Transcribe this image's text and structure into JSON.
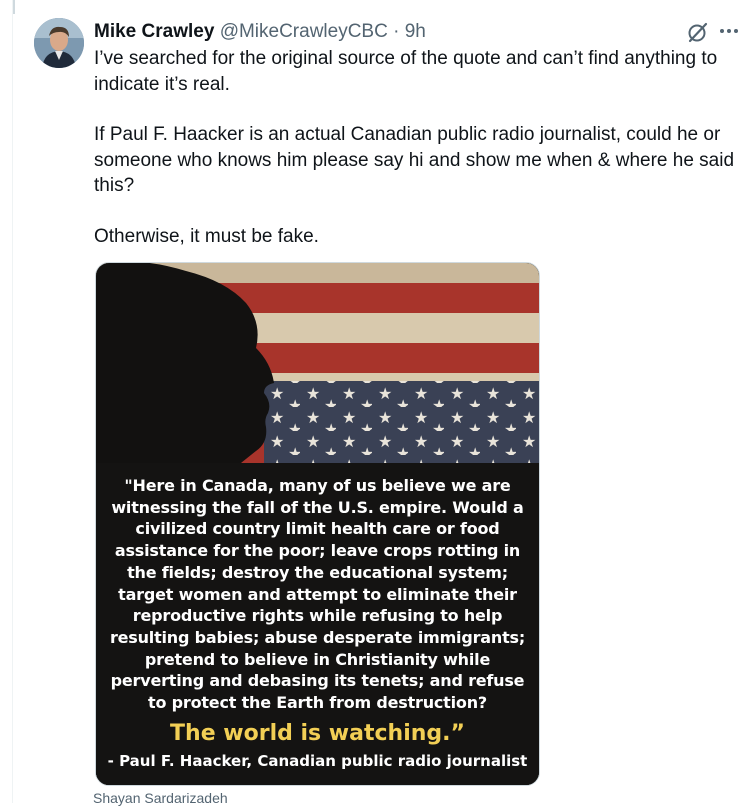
{
  "tweet": {
    "author_name": "Mike Crawley",
    "handle": "@MikeCrawleyCBC",
    "separator": "·",
    "time": "9h",
    "paragraphs": [
      "I’ve searched for the original source of the quote and can’t find anything to indicate it’s real.",
      "If Paul F. Haacker is an actual Canadian public radio journalist, could he or someone who knows him please say hi and show me when & where he said this?",
      "Otherwise, it must be fake."
    ]
  },
  "media": {
    "quote": "\"Here in Canada, many of us believe we are witnessing the fall of the U.S. empire. Would a civilized country limit health care or food assistance for the poor; leave crops rotting in the fields; destroy the educational system; target women and attempt to eliminate their reproductive rights while refusing to help resulting babies; abuse desperate immigrants; pretend to believe in Christianity while perverting and debasing its tenets; and refuse to protect the Earth from destruction?",
    "tagline": "The world is watching.”",
    "attribution": "- Paul F. Haacker, Canadian public radio journalist"
  },
  "credit": "Shayan Sardarizadeh",
  "icons": {
    "grok": "grok-icon",
    "more": "more-options-icon"
  },
  "colors": {
    "tagline": "#f2cf55",
    "secondary_text": "#536471",
    "border": "#cfd9de"
  }
}
